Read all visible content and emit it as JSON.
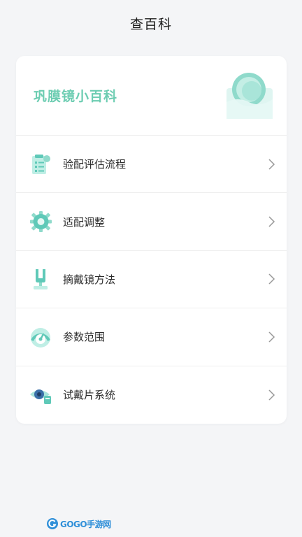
{
  "header": {
    "title": "查百科"
  },
  "card": {
    "heading": "巩膜镜小百科",
    "items": [
      {
        "label": "验配评估流程",
        "icon": "clipboard-checklist-icon"
      },
      {
        "label": "适配调整",
        "icon": "gear-adjust-icon"
      },
      {
        "label": "摘戴镜方法",
        "icon": "lens-remover-tool-icon"
      },
      {
        "label": "参数范围",
        "icon": "gauge-meter-icon"
      },
      {
        "label": "试戴片系统",
        "icon": "eye-lens-icon"
      }
    ]
  },
  "watermark": {
    "text": "GOGO手游网"
  },
  "colors": {
    "accent": "#6dcdb2",
    "icon_primary": "#5fc9b8",
    "icon_secondary": "#a9e4db",
    "background": "#f4f5f7"
  }
}
